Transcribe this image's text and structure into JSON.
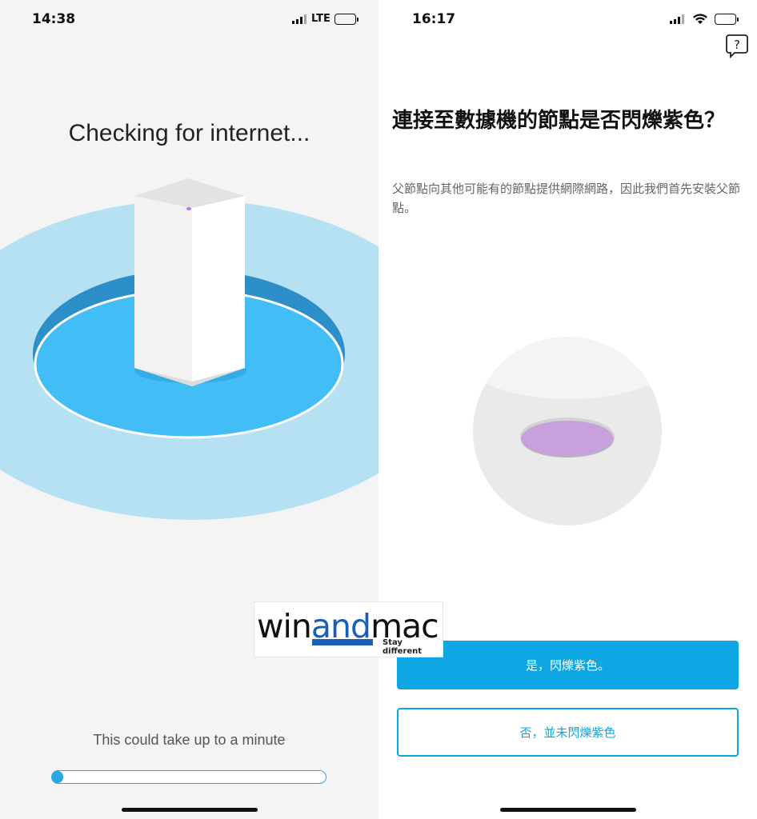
{
  "left": {
    "status": {
      "time": "14:38",
      "network": "LTE"
    },
    "headline": "Checking for internet...",
    "subtext": "This could take up to a minute",
    "progress": 0.03
  },
  "right": {
    "status": {
      "time": "16:17"
    },
    "help_icon": "question-bubble-icon",
    "headline": "連接至數據機的節點是否閃爍紫色？",
    "description": "父節點向其他可能有的節點提供網際網路，因此我們首先安裝父節點。",
    "led_color": "#c7a0dd",
    "buttons": {
      "yes": "是，閃爍紫色。",
      "no": "否，並未閃爍紫色"
    }
  },
  "watermark": {
    "prefix": "win",
    "accent": "and",
    "suffix": "mac",
    "tagline": "Stay different"
  },
  "colors": {
    "accent": "#0ea7e3",
    "ring": "#42bdf5",
    "ring_outer": "#b6e1f3"
  }
}
